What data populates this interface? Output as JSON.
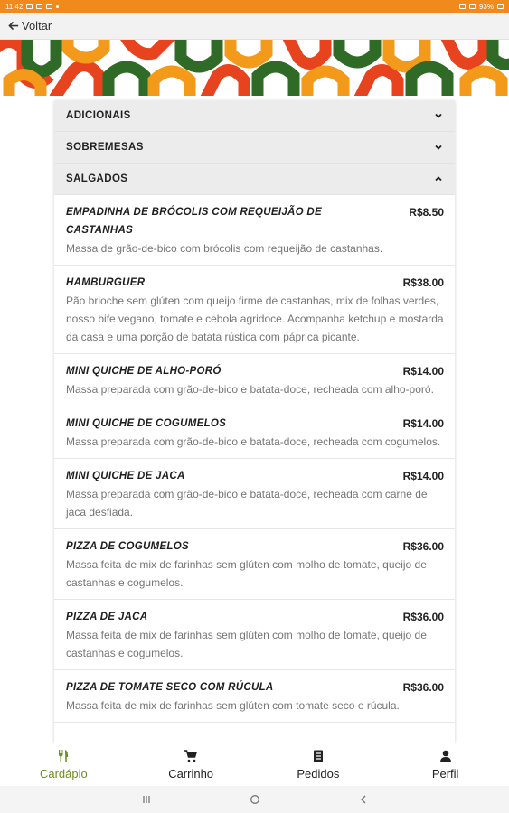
{
  "status_bar": {
    "time": "11:42",
    "battery": "93%"
  },
  "header": {
    "back_label": "Voltar"
  },
  "categories": [
    {
      "label": "ADICIONAIS",
      "expanded": false
    },
    {
      "label": "SOBREMESAS",
      "expanded": false
    },
    {
      "label": "SALGADOS",
      "expanded": true
    }
  ],
  "items": [
    {
      "name": "EMPADINHA DE BRÓCOLIS COM REQUEIJÃO DE CASTANHAS",
      "price": "R$8.50",
      "description": "Massa de grão-de-bico com brócolis com requeijão de castanhas."
    },
    {
      "name": "HAMBURGUER",
      "price": "R$38.00",
      "description": "Pão brioche sem glúten com queijo firme de castanhas, mix de folhas verdes, nosso bife vegano, tomate e cebola agridoce. Acompanha ketchup e mostarda da casa e uma porção de batata rústica com páprica picante."
    },
    {
      "name": "MINI QUICHE DE ALHO-PORÓ",
      "price": "R$14.00",
      "description": "Massa preparada com grão-de-bico e batata-doce, recheada com alho-poró."
    },
    {
      "name": "MINI QUICHE DE COGUMELOS",
      "price": "R$14.00",
      "description": "Massa preparada com grão-de-bico e batata-doce, recheada com cogumelos."
    },
    {
      "name": "MINI QUICHE DE JACA",
      "price": "R$14.00",
      "description": "Massa preparada com grão-de-bico e batata-doce, recheada com carne de jaca desfiada."
    },
    {
      "name": "PIZZA DE COGUMELOS",
      "price": "R$36.00",
      "description": "Massa feita de mix de farinhas sem glúten com molho de tomate, queijo de castanhas e cogumelos."
    },
    {
      "name": "PIZZA DE JACA",
      "price": "R$36.00",
      "description": "Massa feita de mix de farinhas sem glúten com molho de tomate, queijo de castanhas e cogumelos."
    },
    {
      "name": "PIZZA DE TOMATE SECO COM RÚCULA",
      "price": "R$36.00",
      "description": "Massa feita de mix de farinhas sem glúten com tomate seco e rúcula."
    }
  ],
  "bottom_nav": [
    {
      "label": "Cardápio",
      "icon": "utensils-icon",
      "active": true
    },
    {
      "label": "Carrinho",
      "icon": "cart-icon",
      "active": false
    },
    {
      "label": "Pedidos",
      "icon": "orders-icon",
      "active": false
    },
    {
      "label": "Perfil",
      "icon": "user-icon",
      "active": false
    }
  ],
  "colors": {
    "status_bar": "#f08a1d",
    "active_nav": "#6e8f22",
    "banner_red": "#e8431f",
    "banner_orange": "#f39a1a",
    "banner_green": "#2f6b26"
  }
}
